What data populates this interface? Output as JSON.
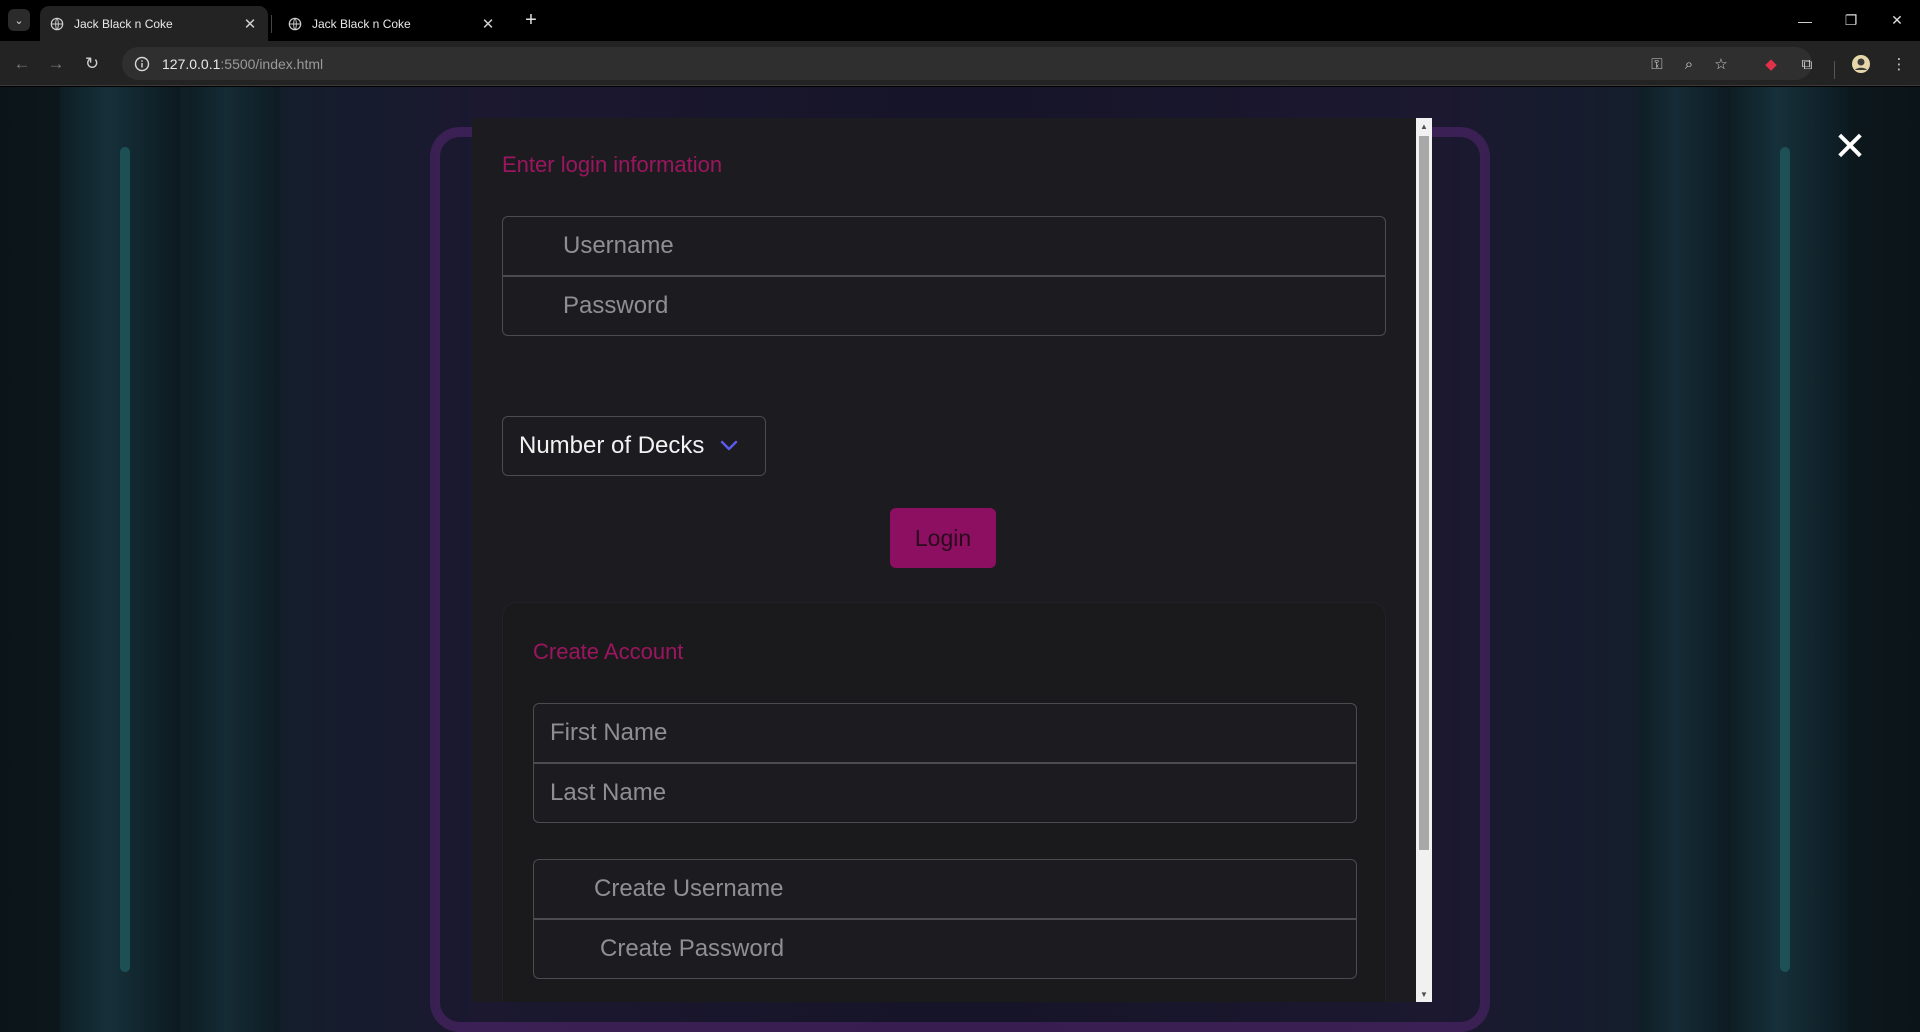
{
  "browser": {
    "tabs": [
      {
        "title": "Jack Black n Coke",
        "active": true
      },
      {
        "title": "Jack Black n Coke",
        "active": false
      }
    ],
    "url_host": "127.0.0.1",
    "url_rest": ":5500/index.html"
  },
  "login": {
    "heading": "Enter login information",
    "username_placeholder": "Username",
    "password_placeholder": "Password",
    "decks_label": "Number of Decks",
    "login_button": "Login"
  },
  "create_account": {
    "heading": "Create Account",
    "first_name_placeholder": "First Name",
    "last_name_placeholder": "Last Name",
    "create_username_placeholder": "Create Username",
    "create_password_placeholder": "Create Password"
  },
  "colors": {
    "accent": "#9c155f",
    "button_bg": "#8c0f61",
    "modal_bg": "#1c1c20",
    "chevron": "#5b5bf0"
  },
  "icons": {
    "close": "close-icon",
    "chevron": "chevron-down-icon"
  }
}
